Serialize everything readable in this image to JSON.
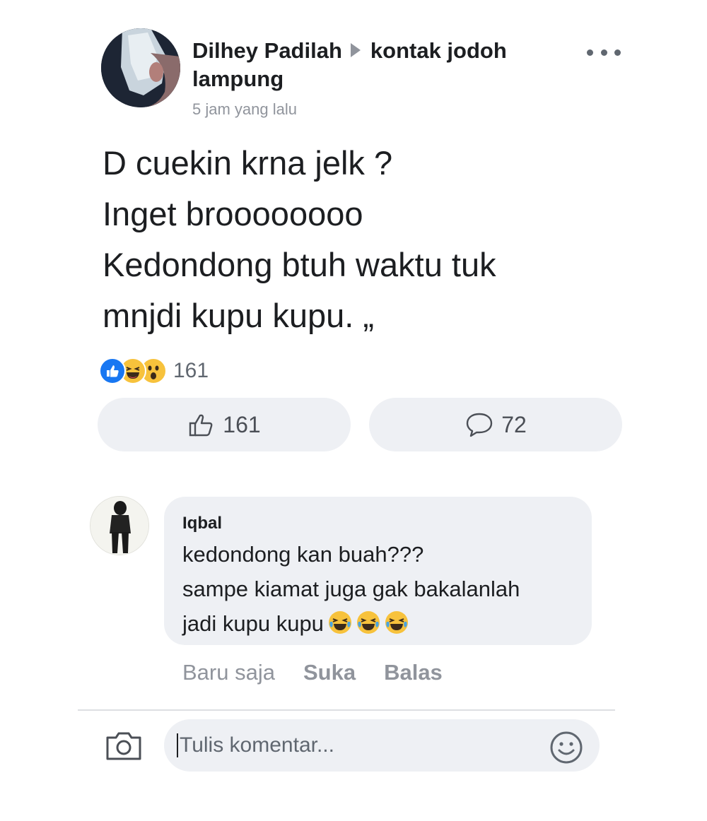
{
  "post": {
    "author": "Dilhey Padilah",
    "group_line1": "kontak jodoh",
    "group_line2": "lampung",
    "time": "5 jam yang lalu",
    "text_lines": [
      "D cuekin krna jelk ?",
      "Inget broooooooo",
      "Kedondong btuh waktu tuk",
      "mnjdi kupu kupu. „"
    ],
    "reactions_summary": {
      "icons": [
        "like-reaction-icon",
        "haha-reaction-icon",
        "wow-reaction-icon"
      ],
      "count": "161"
    },
    "like_pill_count": "161",
    "comment_pill_count": "72"
  },
  "comment": {
    "author": "Iqbal",
    "lines": [
      "kedondong kan buah???",
      "sampe kiamat juga gak bakalanlah",
      "jadi kupu kupu"
    ],
    "trailing_emojis": [
      "laughing-crying-emoji",
      "laughing-crying-emoji",
      "laughing-crying-emoji"
    ],
    "time": "Baru saja",
    "like_label": "Suka",
    "reply_label": "Balas"
  },
  "composer": {
    "placeholder": "Tulis komentar..."
  },
  "colors": {
    "like_blue": "#1877f2",
    "emoji_yellow": "#f7c23c",
    "pill_background": "#eef0f4",
    "secondary_text": "#90949c"
  }
}
